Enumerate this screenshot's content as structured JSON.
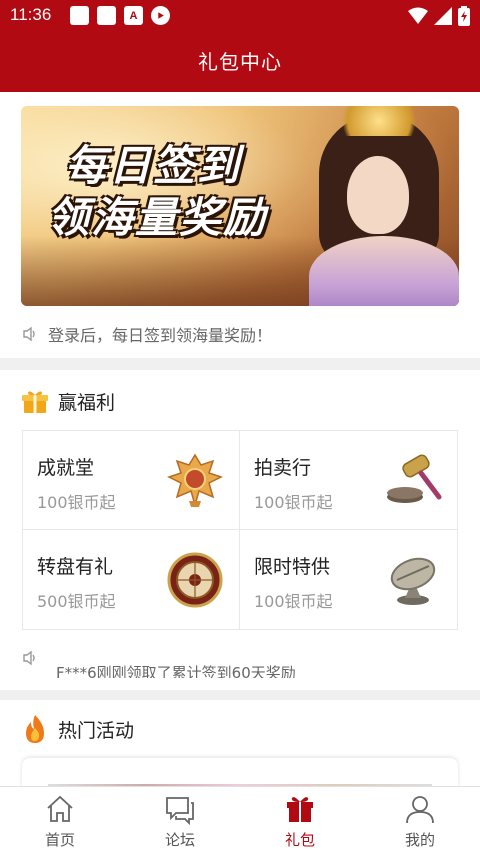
{
  "status_bar": {
    "time": "11:36",
    "icons": [
      "square-icon",
      "square-icon",
      "a-icon",
      "shield-icon",
      "wifi-icon",
      "signal-icon",
      "battery-icon"
    ],
    "a_glyph": "A"
  },
  "header": {
    "title": "礼包中心"
  },
  "banner": {
    "line1": "每日签到",
    "line2": "领海量奖励"
  },
  "notice": {
    "text": "登录后，每日签到领海量奖励！"
  },
  "welfare": {
    "title": "赢福利",
    "items": [
      {
        "title": "成就堂",
        "subtitle": "100银币起",
        "icon": "trophy-icon"
      },
      {
        "title": "拍卖行",
        "subtitle": "100银币起",
        "icon": "gavel-icon"
      },
      {
        "title": "转盘有礼",
        "subtitle": "500银币起",
        "icon": "wheel-icon"
      },
      {
        "title": "限时特供",
        "subtitle": "100银币起",
        "icon": "compass-icon"
      }
    ]
  },
  "ticker": {
    "text": "F***6刚刚领取了累计签到60天奖励"
  },
  "hot": {
    "title": "热门活动"
  },
  "tabs": [
    {
      "label": "首页",
      "icon": "home-icon",
      "active": false
    },
    {
      "label": "论坛",
      "icon": "chat-icon",
      "active": false
    },
    {
      "label": "礼包",
      "icon": "gift-icon",
      "active": true
    },
    {
      "label": "我的",
      "icon": "user-icon",
      "active": false
    }
  ],
  "colors": {
    "brand": "#b10a12",
    "background": "#f0f0f0",
    "card": "#ffffff",
    "muted_text": "#999999"
  }
}
